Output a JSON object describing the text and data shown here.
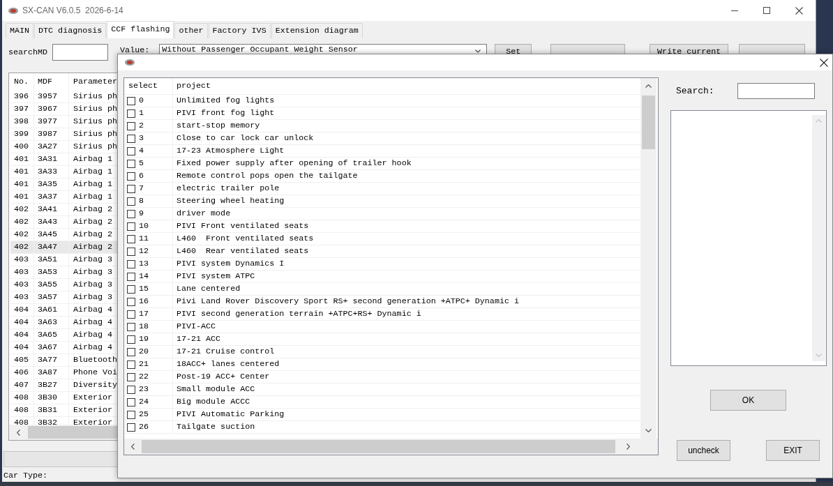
{
  "window": {
    "title": "SX-CAN V6.0.5  2026-6-14"
  },
  "tabs": [
    {
      "label": "MAIN",
      "selected": false
    },
    {
      "label": "DTC diagnosis",
      "selected": false
    },
    {
      "label": "CCF flashing",
      "selected": true
    },
    {
      "label": "other",
      "selected": false
    },
    {
      "label": "Factory IVS",
      "selected": false
    },
    {
      "label": "Extension diagram",
      "selected": false
    }
  ],
  "toolbar": {
    "search_label": "searchMD",
    "value_label": "Value:",
    "value_select": "Without Passenger Occupant Weight Sensor",
    "buttons": [
      {
        "kind": "labeled",
        "label": "Set"
      },
      {
        "kind": "covered"
      },
      {
        "kind": "labeled",
        "label": "Write current"
      },
      {
        "kind": "covered"
      }
    ]
  },
  "table": {
    "columns": [
      "No.",
      "MDF",
      "Parameter"
    ],
    "rows": [
      {
        "cells": [
          "396",
          "3957",
          "Sirius ph"
        ],
        "selected": false
      },
      {
        "cells": [
          "397",
          "3967",
          "Sirius ph"
        ],
        "selected": false
      },
      {
        "cells": [
          "398",
          "3977",
          "Sirius ph"
        ],
        "selected": false
      },
      {
        "cells": [
          "399",
          "3987",
          "Sirius ph"
        ],
        "selected": false
      },
      {
        "cells": [
          "400",
          "3A27",
          "Sirius ph"
        ],
        "selected": false
      },
      {
        "cells": [
          "401",
          "3A31",
          "Airbag 1"
        ],
        "selected": false
      },
      {
        "cells": [
          "401",
          "3A33",
          "Airbag 1"
        ],
        "selected": false
      },
      {
        "cells": [
          "401",
          "3A35",
          "Airbag 1"
        ],
        "selected": false
      },
      {
        "cells": [
          "401",
          "3A37",
          "Airbag 1"
        ],
        "selected": false
      },
      {
        "cells": [
          "402",
          "3A41",
          "Airbag 2"
        ],
        "selected": false
      },
      {
        "cells": [
          "402",
          "3A43",
          "Airbag 2"
        ],
        "selected": false
      },
      {
        "cells": [
          "402",
          "3A45",
          "Airbag 2"
        ],
        "selected": false
      },
      {
        "cells": [
          "402",
          "3A47",
          "Airbag 2"
        ],
        "selected": true
      },
      {
        "cells": [
          "403",
          "3A51",
          "Airbag 3"
        ],
        "selected": false
      },
      {
        "cells": [
          "403",
          "3A53",
          "Airbag 3"
        ],
        "selected": false
      },
      {
        "cells": [
          "403",
          "3A55",
          "Airbag 3"
        ],
        "selected": false
      },
      {
        "cells": [
          "403",
          "3A57",
          "Airbag 3"
        ],
        "selected": false
      },
      {
        "cells": [
          "404",
          "3A61",
          "Airbag 4"
        ],
        "selected": false
      },
      {
        "cells": [
          "404",
          "3A63",
          "Airbag 4"
        ],
        "selected": false
      },
      {
        "cells": [
          "404",
          "3A65",
          "Airbag 4"
        ],
        "selected": false
      },
      {
        "cells": [
          "404",
          "3A67",
          "Airbag 4"
        ],
        "selected": false
      },
      {
        "cells": [
          "405",
          "3A77",
          "Bluetooth"
        ],
        "selected": false
      },
      {
        "cells": [
          "406",
          "3A87",
          "Phone Voi"
        ],
        "selected": false
      },
      {
        "cells": [
          "407",
          "3B27",
          "Diversity"
        ],
        "selected": false
      },
      {
        "cells": [
          "408",
          "3B30",
          "Exterior"
        ],
        "selected": false
      },
      {
        "cells": [
          "408",
          "3B31",
          "Exterior"
        ],
        "selected": false
      },
      {
        "cells": [
          "408",
          "3B32",
          "Exterior"
        ],
        "selected": false
      }
    ]
  },
  "status_bar": {
    "car_type_label": "Car Type:"
  },
  "dialog": {
    "list": {
      "columns": [
        "select",
        "project"
      ],
      "rows": [
        {
          "number": "0",
          "project": "Unlimited fog lights",
          "checked": false
        },
        {
          "number": "1",
          "project": "PIVI front fog light",
          "checked": false
        },
        {
          "number": "2",
          "project": "start-stop memory",
          "checked": false
        },
        {
          "number": "3",
          "project": "Close to car lock car unlock",
          "checked": false
        },
        {
          "number": "4",
          "project": "17-23 Atmosphere Light",
          "checked": false
        },
        {
          "number": "5",
          "project": "Fixed power supply after opening of trailer hook",
          "checked": false
        },
        {
          "number": "6",
          "project": "Remote control pops open the tailgate",
          "checked": false
        },
        {
          "number": "7",
          "project": "electric trailer pole",
          "checked": false
        },
        {
          "number": "8",
          "project": "Steering wheel heating",
          "checked": false
        },
        {
          "number": "9",
          "project": "driver mode",
          "checked": false
        },
        {
          "number": "10",
          "project": "PIVI Front ventilated seats",
          "checked": false
        },
        {
          "number": "11",
          "project": "L460  Front ventilated seats",
          "checked": false
        },
        {
          "number": "12",
          "project": "L460  Rear ventilated seats",
          "checked": false
        },
        {
          "number": "13",
          "project": "PIVI system Dynamics I",
          "checked": false
        },
        {
          "number": "14",
          "project": "PIVI system ATPC",
          "checked": false
        },
        {
          "number": "15",
          "project": "Lane centered",
          "checked": false
        },
        {
          "number": "16",
          "project": "Pivi Land Rover Discovery Sport RS+ second generation +ATPC+ Dynamic i",
          "checked": false
        },
        {
          "number": "17",
          "project": "PIVI second generation terrain +ATPC+RS+ Dynamic i",
          "checked": false
        },
        {
          "number": "18",
          "project": "PIVI-ACC",
          "checked": false
        },
        {
          "number": "19",
          "project": "17-21 ACC",
          "checked": false
        },
        {
          "number": "20",
          "project": "17-21 Cruise control",
          "checked": false
        },
        {
          "number": "21",
          "project": "18ACC+ lanes centered",
          "checked": false
        },
        {
          "number": "22",
          "project": "Post-19 ACC+ Center",
          "checked": false
        },
        {
          "number": "23",
          "project": "Small module ACC",
          "checked": false
        },
        {
          "number": "24",
          "project": "Big module ACCC",
          "checked": false
        },
        {
          "number": "25",
          "project": "PIVI Automatic Parking",
          "checked": false
        },
        {
          "number": "26",
          "project": "Tailgate suction",
          "checked": false
        }
      ]
    },
    "search": {
      "label": "Search:"
    },
    "buttons": [
      {
        "label": "OK"
      },
      {
        "label": "uncheck"
      },
      {
        "label": "EXIT"
      }
    ]
  }
}
